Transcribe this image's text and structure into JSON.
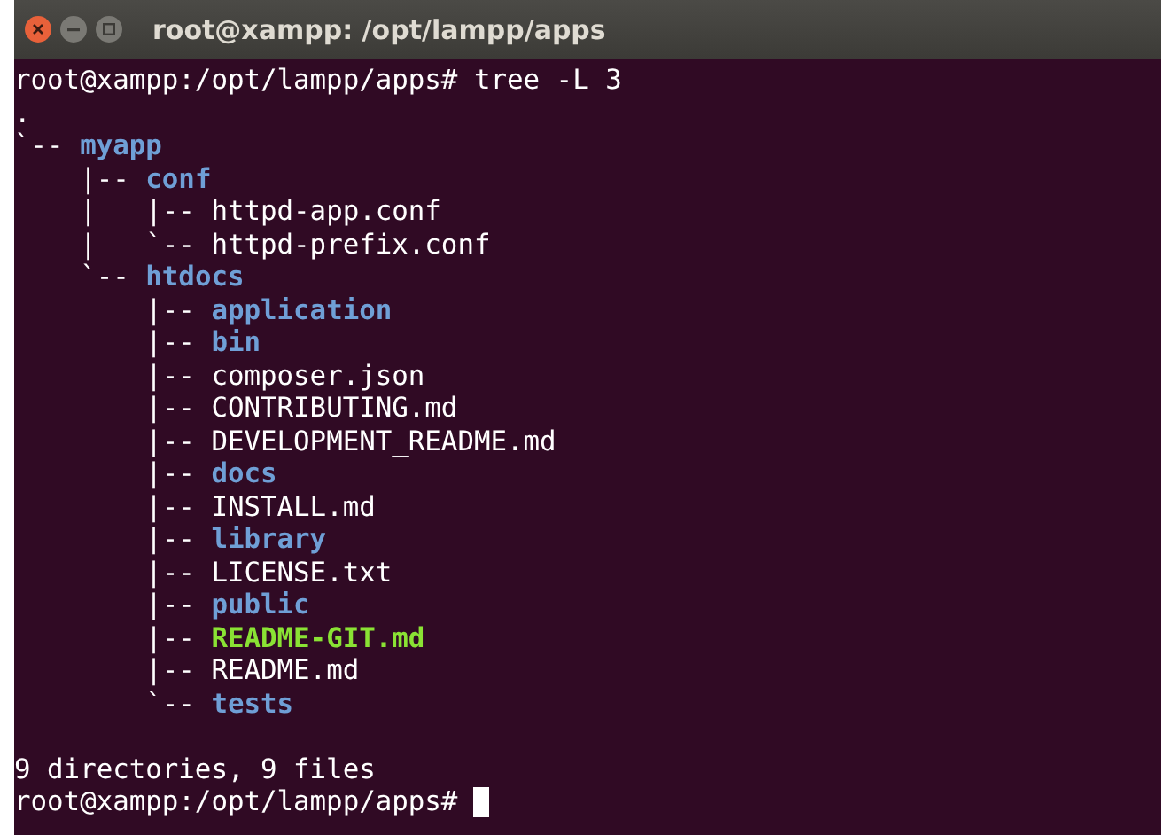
{
  "window": {
    "title": "root@xampp: /opt/lampp/apps"
  },
  "command": {
    "prompt": "root@xampp:/opt/lampp/apps#",
    "input": "tree -L 3"
  },
  "tree_root": ".",
  "entries": [
    {
      "prefix": "`-- ",
      "name": "myapp",
      "kind": "dir"
    },
    {
      "prefix": "    |-- ",
      "name": "conf",
      "kind": "dir"
    },
    {
      "prefix": "    |   |-- ",
      "name": "httpd-app.conf",
      "kind": "file"
    },
    {
      "prefix": "    |   `-- ",
      "name": "httpd-prefix.conf",
      "kind": "file"
    },
    {
      "prefix": "    `-- ",
      "name": "htdocs",
      "kind": "dir"
    },
    {
      "prefix": "        |-- ",
      "name": "application",
      "kind": "dir"
    },
    {
      "prefix": "        |-- ",
      "name": "bin",
      "kind": "dir"
    },
    {
      "prefix": "        |-- ",
      "name": "composer.json",
      "kind": "file"
    },
    {
      "prefix": "        |-- ",
      "name": "CONTRIBUTING.md",
      "kind": "file"
    },
    {
      "prefix": "        |-- ",
      "name": "DEVELOPMENT_README.md",
      "kind": "file"
    },
    {
      "prefix": "        |-- ",
      "name": "docs",
      "kind": "dir"
    },
    {
      "prefix": "        |-- ",
      "name": "INSTALL.md",
      "kind": "file"
    },
    {
      "prefix": "        |-- ",
      "name": "library",
      "kind": "dir"
    },
    {
      "prefix": "        |-- ",
      "name": "LICENSE.txt",
      "kind": "file"
    },
    {
      "prefix": "        |-- ",
      "name": "public",
      "kind": "dir"
    },
    {
      "prefix": "        |-- ",
      "name": "README-GIT.md",
      "kind": "exec"
    },
    {
      "prefix": "        |-- ",
      "name": "README.md",
      "kind": "file"
    },
    {
      "prefix": "        `-- ",
      "name": "tests",
      "kind": "dir"
    }
  ],
  "summary": "9 directories, 9 files",
  "final_prompt": "root@xampp:/opt/lampp/apps#"
}
